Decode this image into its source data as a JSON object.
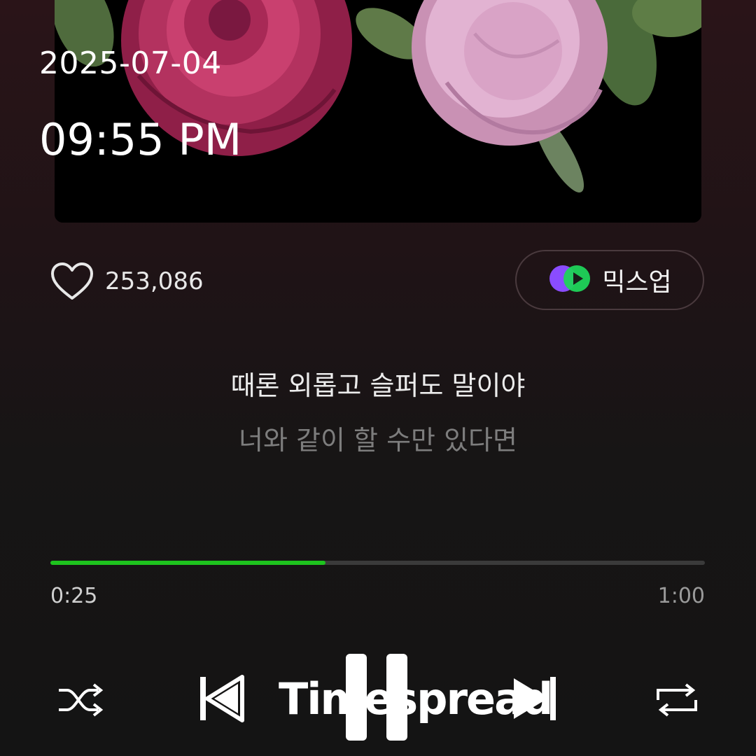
{
  "overlay": {
    "date": "2025-07-04",
    "time": "09:55 PM"
  },
  "album_art": {
    "icon": "flower-artwork"
  },
  "like": {
    "icon": "heart-outline-icon",
    "count": "253,086"
  },
  "mixup": {
    "label": "믹스업",
    "icon": "mixup-logo-icon"
  },
  "lyrics": {
    "current": "때론 외롭고 슬퍼도 말이야",
    "next": "너와 같이 할 수만 있다면"
  },
  "progress": {
    "elapsed": "0:25",
    "total": "1:00",
    "fraction": 0.42,
    "color": "#1ec31e"
  },
  "controls": {
    "shuffle_icon": "shuffle-icon",
    "prev_icon": "previous-track-icon",
    "pause_icon": "pause-icon",
    "next_icon": "next-track-icon",
    "repeat_icon": "repeat-icon"
  },
  "watermark": {
    "text": "Timespread"
  }
}
